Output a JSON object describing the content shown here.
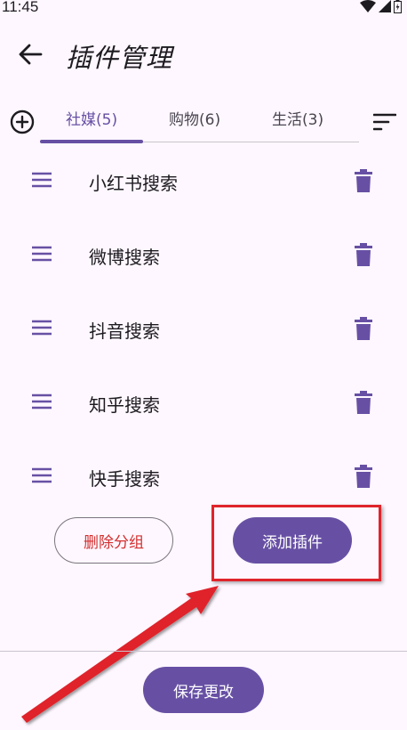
{
  "status_bar": {
    "time": "11:45"
  },
  "app_bar": {
    "title": "插件管理"
  },
  "tabs": [
    {
      "label": "社媒(5)",
      "active": true
    },
    {
      "label": "购物(6)",
      "active": false
    },
    {
      "label": "生活(3)",
      "active": false
    }
  ],
  "plugins": [
    {
      "label": "小红书搜索"
    },
    {
      "label": "微博搜索"
    },
    {
      "label": "抖音搜索"
    },
    {
      "label": "知乎搜索"
    },
    {
      "label": "快手搜索"
    }
  ],
  "actions": {
    "delete_group": "删除分组",
    "add_plugin": "添加插件",
    "save_changes": "保存更改"
  },
  "colors": {
    "primary": "#6750a4",
    "danger_text": "#d32f2f",
    "highlight": "#e0242b",
    "background": "#fef7ff"
  },
  "icons": [
    "back-arrow-icon",
    "add-circle-icon",
    "sort-icon",
    "drag-handle-icon",
    "trash-icon",
    "wifi-icon",
    "signal-icon",
    "battery-icon"
  ]
}
